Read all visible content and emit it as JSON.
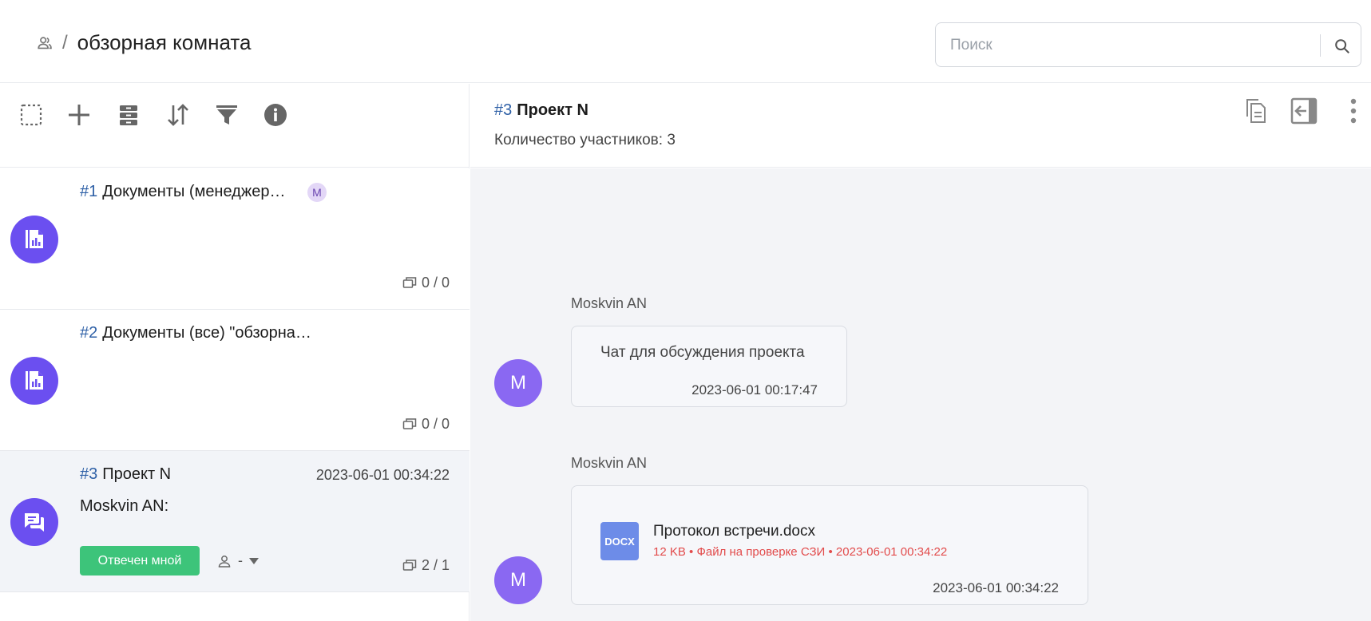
{
  "header": {
    "breadcrumb_sep": "/",
    "room_title": "обзорная комната",
    "search_placeholder": "Поиск"
  },
  "toolbar": {
    "icons": [
      "select-icon",
      "add-icon",
      "archive-icon",
      "sort-icon",
      "filter-icon",
      "info-icon"
    ]
  },
  "chats": [
    {
      "num": "#1",
      "name": "Документы (менеджер…",
      "badge": "M",
      "counter": "0 / 0",
      "icon": "document-chart-icon"
    },
    {
      "num": "#2",
      "name": "Документы (все) \"обзорна…",
      "counter": "0 / 0",
      "icon": "document-chart-icon"
    },
    {
      "num": "#3",
      "name": "Проект N",
      "date": "2023-06-01 00:34:22",
      "last_sender": "Moskvin AN:",
      "status_label": "Отвечен мной",
      "assignee": "-",
      "counter": "2 / 1",
      "icon": "chat-bubbles-icon"
    }
  ],
  "conversation": {
    "num": "#3",
    "name": "Проект N",
    "participants": "Количество участников: 3"
  },
  "messages": [
    {
      "sender": "Moskvin AN",
      "avatar": "M",
      "text": "Чат для обсуждения проекта",
      "time": "2023-06-01 00:17:47"
    },
    {
      "sender": "Moskvin AN",
      "avatar": "M",
      "file_ext": "DOCX",
      "file_name": "Протокол встречи.docx",
      "file_meta": "12 KB • Файл на проверке СЗИ • 2023-06-01 00:34:22",
      "time": "2023-06-01 00:34:22"
    }
  ],
  "colors": {
    "accent": "#6b4ff0",
    "number": "#2d5fa6",
    "answered_badge": "#3dc47a",
    "file_meta": "#e24b4b",
    "docx_icon": "#6d8ce8"
  }
}
